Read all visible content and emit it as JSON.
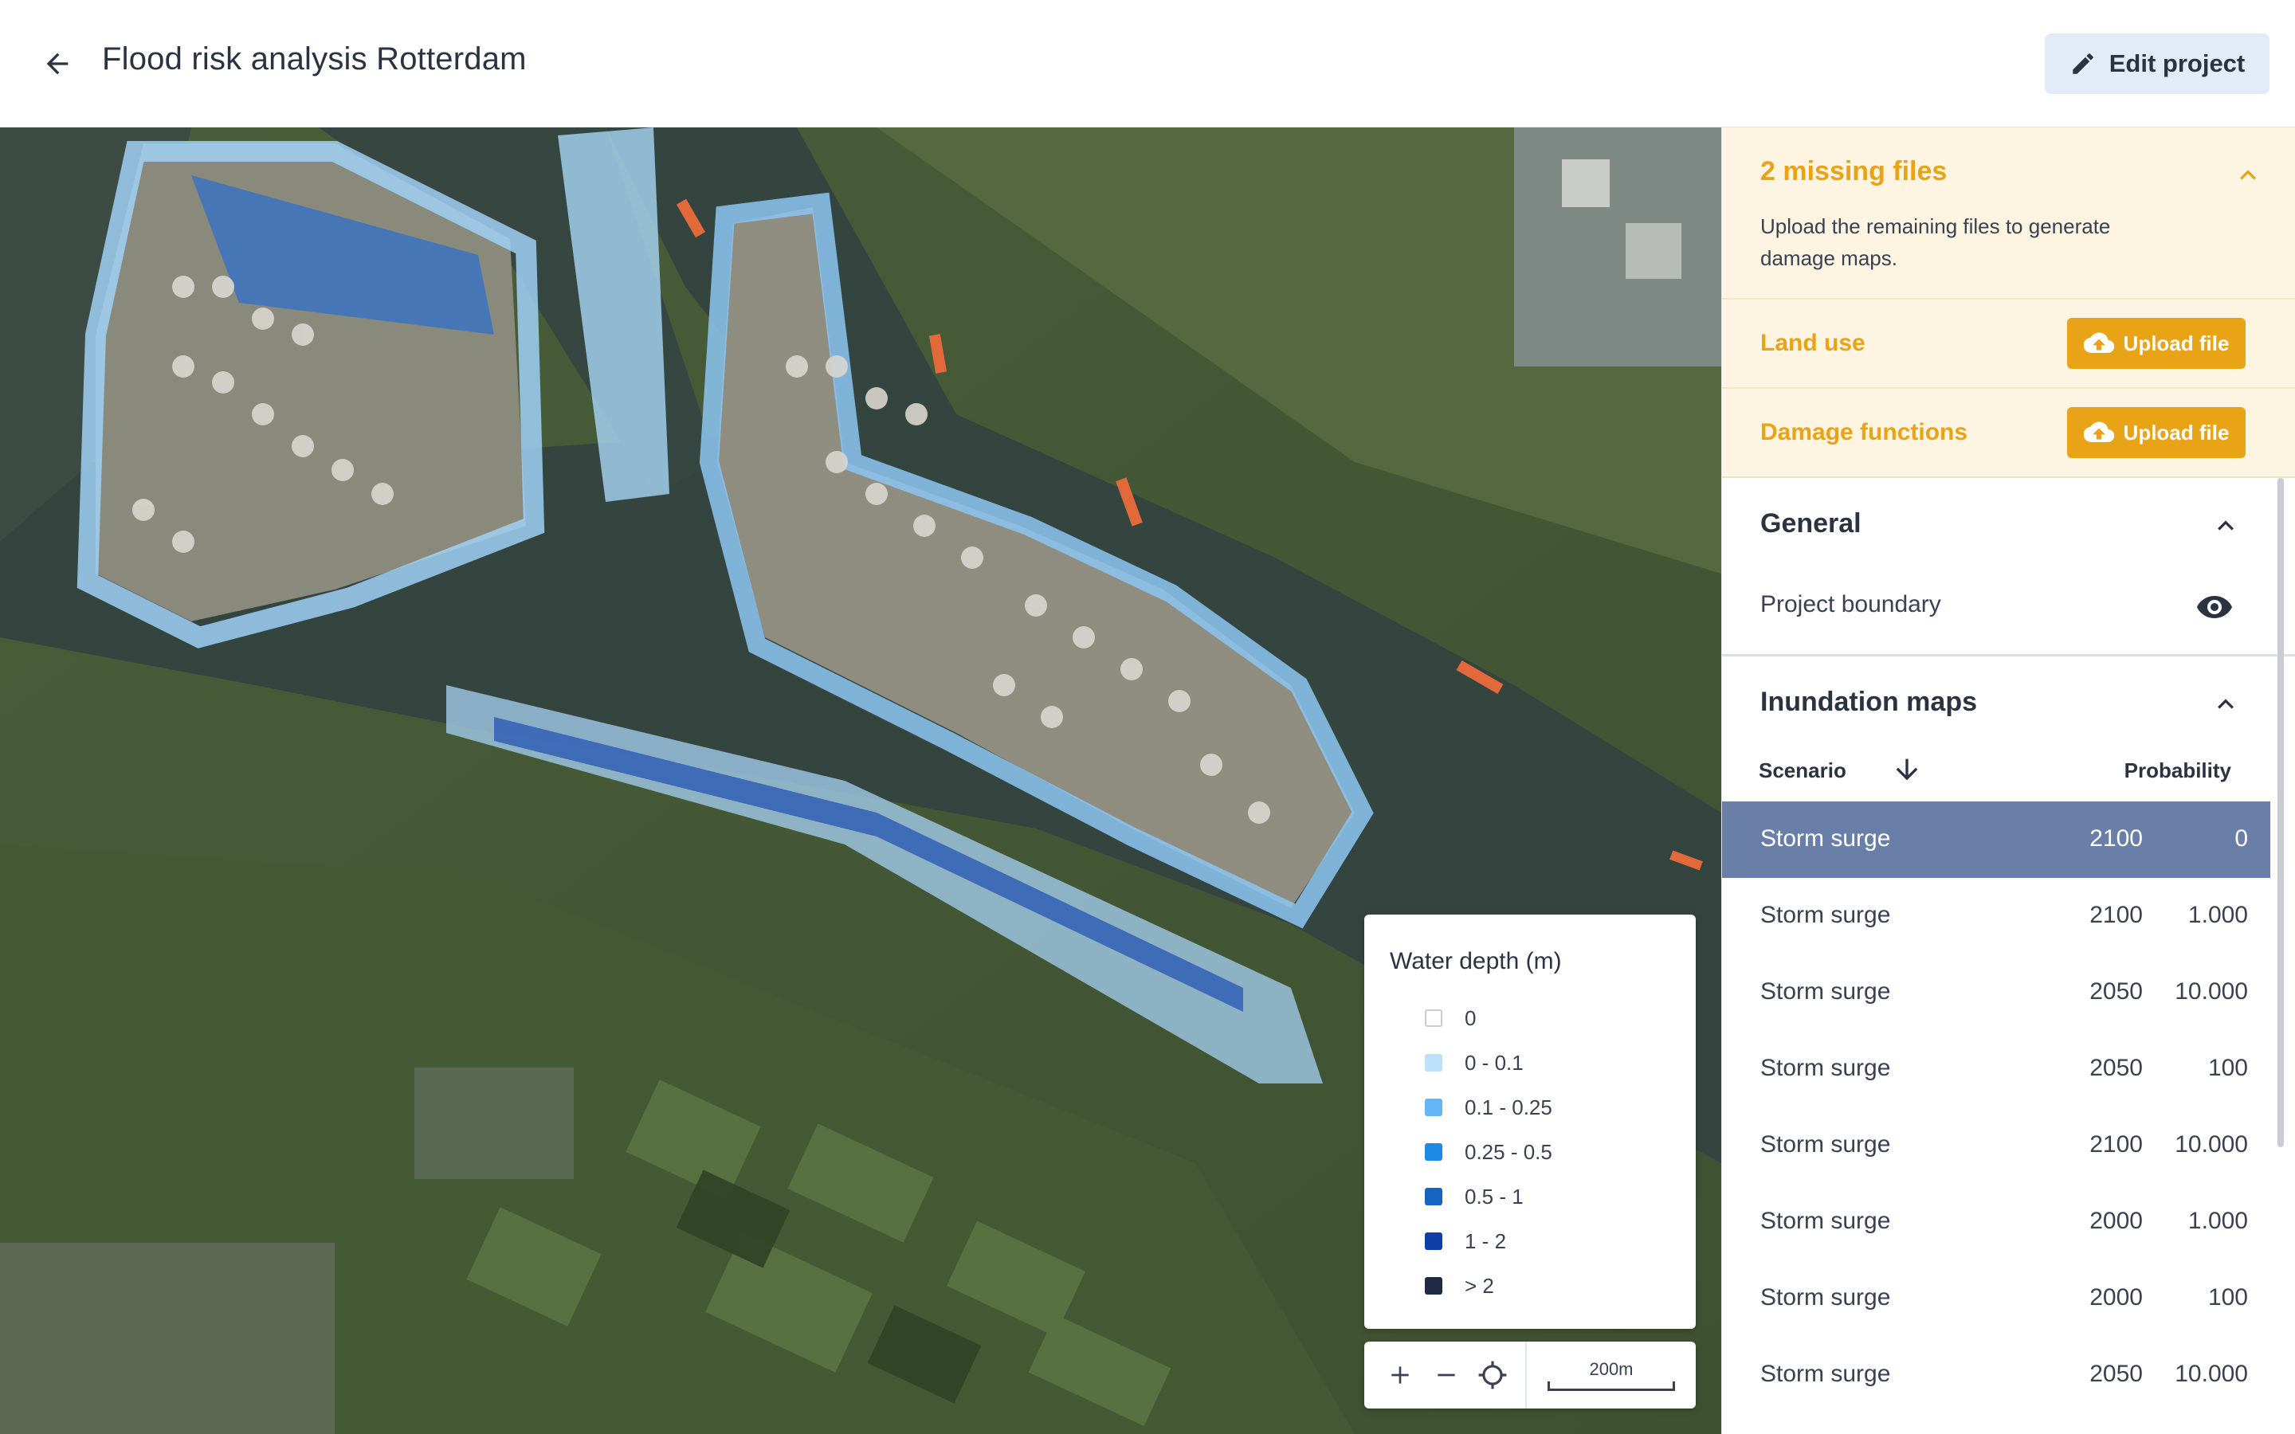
{
  "header": {
    "title": "Flood risk analysis Rotterdam",
    "edit_label": "Edit project"
  },
  "legend": {
    "title": "Water depth (m)",
    "items": [
      {
        "label": "0",
        "color": "#ffffff"
      },
      {
        "label": "0 - 0.1",
        "color": "#bde0fb"
      },
      {
        "label": "0.1 - 0.25",
        "color": "#64b5f6"
      },
      {
        "label": "0.25 - 0.5",
        "color": "#1e88e5"
      },
      {
        "label": "0.5 - 1",
        "color": "#1565c0"
      },
      {
        "label": "1 - 2",
        "color": "#0d3fa6"
      },
      {
        "label": "> 2",
        "color": "#1f2a44"
      }
    ]
  },
  "map_controls": {
    "scale_label": "200m"
  },
  "missing": {
    "title": "2 missing files",
    "description": "Upload the remaining files to generate damage maps.",
    "rows": [
      {
        "label": "Land use",
        "button": "Upload file"
      },
      {
        "label": "Damage functions",
        "button": "Upload file"
      }
    ]
  },
  "general": {
    "title": "General",
    "boundary_label": "Project boundary"
  },
  "inundation": {
    "title": "Inundation maps",
    "col_scenario": "Scenario",
    "col_probability": "Probability",
    "rows": [
      {
        "name": "Storm surge",
        "year": "2100",
        "probability": "0",
        "selected": true
      },
      {
        "name": "Storm surge",
        "year": "2100",
        "probability": "1.000"
      },
      {
        "name": "Storm surge",
        "year": "2050",
        "probability": "10.000"
      },
      {
        "name": "Storm surge",
        "year": "2050",
        "probability": "100"
      },
      {
        "name": "Storm surge",
        "year": "2100",
        "probability": "10.000"
      },
      {
        "name": "Storm surge",
        "year": "2000",
        "probability": "1.000"
      },
      {
        "name": "Storm surge",
        "year": "2000",
        "probability": "100"
      },
      {
        "name": "Storm surge",
        "year": "2050",
        "probability": "10.000"
      }
    ]
  },
  "colors": {
    "accent_warning": "#e8a317",
    "selected_row": "#6a7fa8",
    "edit_button_bg": "#e2ebf8"
  }
}
